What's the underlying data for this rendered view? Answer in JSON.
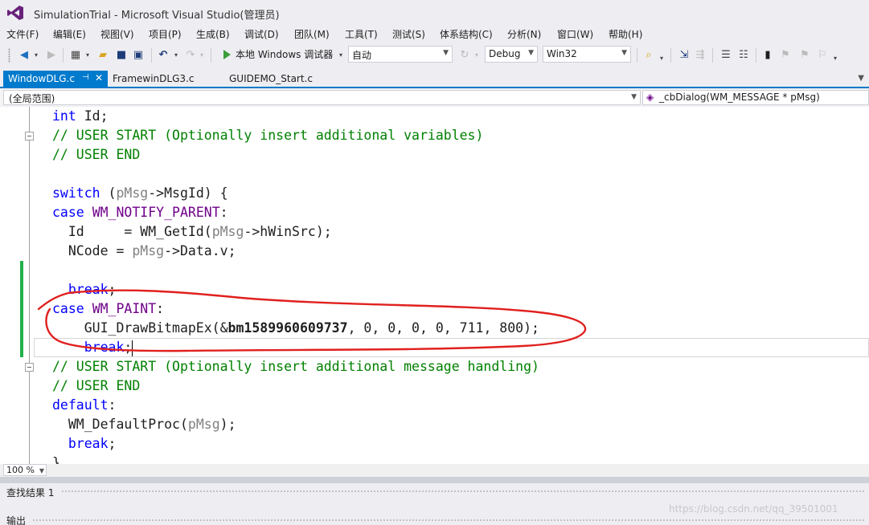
{
  "window": {
    "title": "SimulationTrial - Microsoft Visual Studio(管理员)"
  },
  "menu": [
    {
      "label": "文件(F)"
    },
    {
      "label": "编辑(E)"
    },
    {
      "label": "视图(V)"
    },
    {
      "label": "项目(P)"
    },
    {
      "label": "生成(B)"
    },
    {
      "label": "调试(D)"
    },
    {
      "label": "团队(M)"
    },
    {
      "label": "工具(T)"
    },
    {
      "label": "测试(S)"
    },
    {
      "label": "体系结构(C)"
    },
    {
      "label": "分析(N)"
    },
    {
      "label": "窗口(W)"
    },
    {
      "label": "帮助(H)"
    }
  ],
  "toolbar": {
    "run_label": "本地 Windows 调试器",
    "solution_config_partial": "自动",
    "configuration": "Debug",
    "platform": "Win32"
  },
  "tabs": [
    {
      "label": "WindowDLG.c",
      "active": true,
      "close": "✕"
    },
    {
      "label": "FramewinDLG3.c",
      "active": false
    },
    {
      "label": "GUIDEMO_Start.c",
      "active": false
    }
  ],
  "navbar": {
    "scope": "(全局范围)",
    "function": "_cbDialog(WM_MESSAGE * pMsg)"
  },
  "code": {
    "l1": {
      "kw": "int",
      "rest": " Id;"
    },
    "l2": "// USER START (Optionally insert additional variables)",
    "l3": "// USER END",
    "l5": {
      "kw": "switch",
      "a": " (",
      "pm": "pMsg",
      "b": "->MsgId) {"
    },
    "l6": {
      "kw": "case",
      "sp": " ",
      "mc": "WM_NOTIFY_PARENT",
      "b": ":"
    },
    "l7": {
      "a": "  Id     = WM_GetId(",
      "pm": "pMsg",
      "b": "->hWinSrc);"
    },
    "l8": {
      "a": "  NCode = ",
      "pm": "pMsg",
      "b": "->Data.v;"
    },
    "l10": {
      "indent": "  ",
      "kw": "break",
      "b": ";"
    },
    "l11": {
      "kw": "case",
      "sp": " ",
      "mc": "WM_PAINT",
      "b": ":"
    },
    "l12": {
      "a": "    GUI_DrawBitmapEx(&",
      "bold": "bm1589960609737",
      "b": ", 0, 0, 0, 0, 711, 800);"
    },
    "l13": {
      "indent": "    ",
      "kw": "break",
      "b": ";"
    },
    "l14": "// USER START (Optionally insert additional message handling)",
    "l15": "// USER END",
    "l16": {
      "kw": "default",
      "b": ":"
    },
    "l17": {
      "a": "  WM_DefaultProc(",
      "pm": "pMsg",
      "b": ");"
    },
    "l18": {
      "indent": "  ",
      "kw": "break",
      "b": ";"
    },
    "l19": "}"
  },
  "zoom": {
    "level": "100 %"
  },
  "panels": {
    "find_results": "查找结果 1",
    "output": "输出"
  },
  "watermark": "https://blog.csdn.net/qq_39501001",
  "colors": {
    "accent": "#007acc",
    "keyword": "#0000ff",
    "comment": "#008000",
    "macro": "#6f008a",
    "param": "#808080",
    "change_bar": "#22b14c",
    "annotation": "#e0201e"
  }
}
